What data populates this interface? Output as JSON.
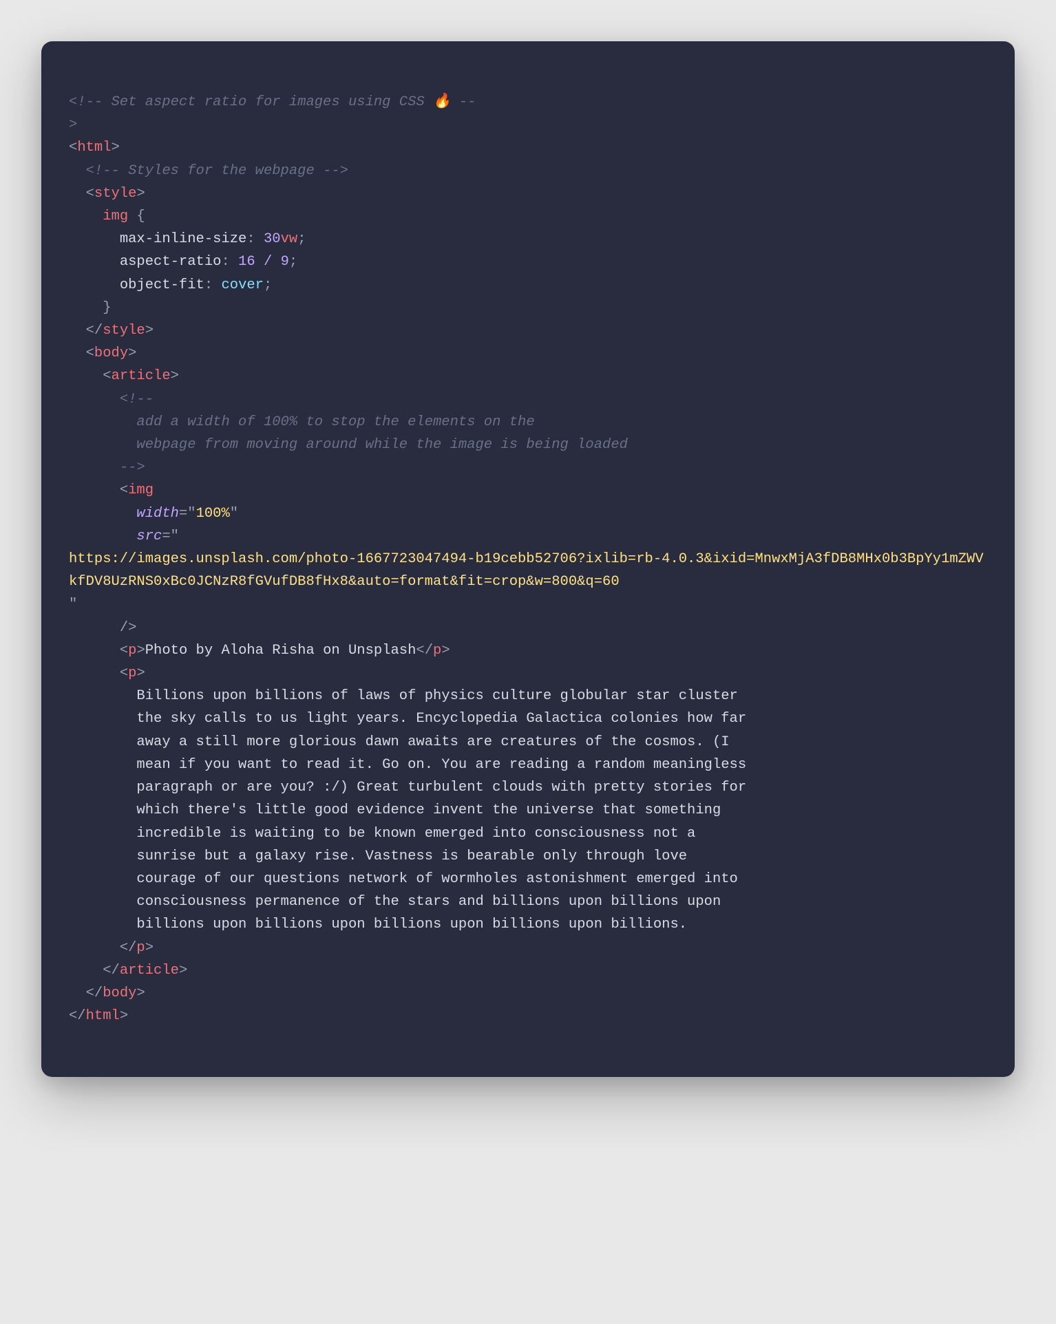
{
  "code": {
    "comment_top_1": "<!-- Set aspect ratio for images using CSS 🔥 --",
    "comment_top_2": ">",
    "tag_html": "html",
    "comment_styles": "<!-- Styles for the webpage -->",
    "tag_style": "style",
    "selector_img": "img",
    "brace_open": "{",
    "prop_max_inline": "max-inline-size",
    "val_30": "30",
    "unit_vw": "vw",
    "prop_aspect": "aspect-ratio",
    "val_16": "16",
    "slash": "/",
    "val_9": "9",
    "prop_object_fit": "object-fit",
    "val_cover": "cover",
    "brace_close": "}",
    "tag_body": "body",
    "tag_article": "article",
    "comment_img_1": "<!--",
    "comment_img_2": "add a width of 100% to stop the elements on the",
    "comment_img_3": "webpage from moving around while the image is being loaded",
    "comment_img_4": "-->",
    "tag_img": "img",
    "attr_width": "width",
    "val_width": "100%",
    "attr_src": "src",
    "url": "https://images.unsplash.com/photo-1667723047494-b19cebb52706?ixlib=rb-4.0.3&ixid=MnwxMjA3fDB8MHx0b3BpYy1mZWVkfDV8UzRNS0xBc0JCNzR8fGVufDB8fHx8&auto=format&fit=crop&w=800&q=60",
    "tag_p": "p",
    "caption": "Photo by Aloha Risha on Unsplash",
    "para_l1": "Billions upon billions of laws of physics culture globular star cluster",
    "para_l2": "the sky calls to us light years. Encyclopedia Galactica colonies how far",
    "para_l3": "away a still more glorious dawn awaits are creatures of the cosmos. (I",
    "para_l4": "mean if you want to read it. Go on. You are reading a random meaningless",
    "para_l5": "paragraph or are you? :/) Great turbulent clouds with pretty stories for",
    "para_l6": "which there's little good evidence invent the universe that something",
    "para_l7": "incredible is waiting to be known emerged into consciousness not a",
    "para_l8": "sunrise but a galaxy rise. Vastness is bearable only through love",
    "para_l9": "courage of our questions network of wormholes astonishment emerged into",
    "para_l10": "consciousness permanence of the stars and billions upon billions upon",
    "para_l11": "billions upon billions upon billions upon billions upon billions."
  }
}
